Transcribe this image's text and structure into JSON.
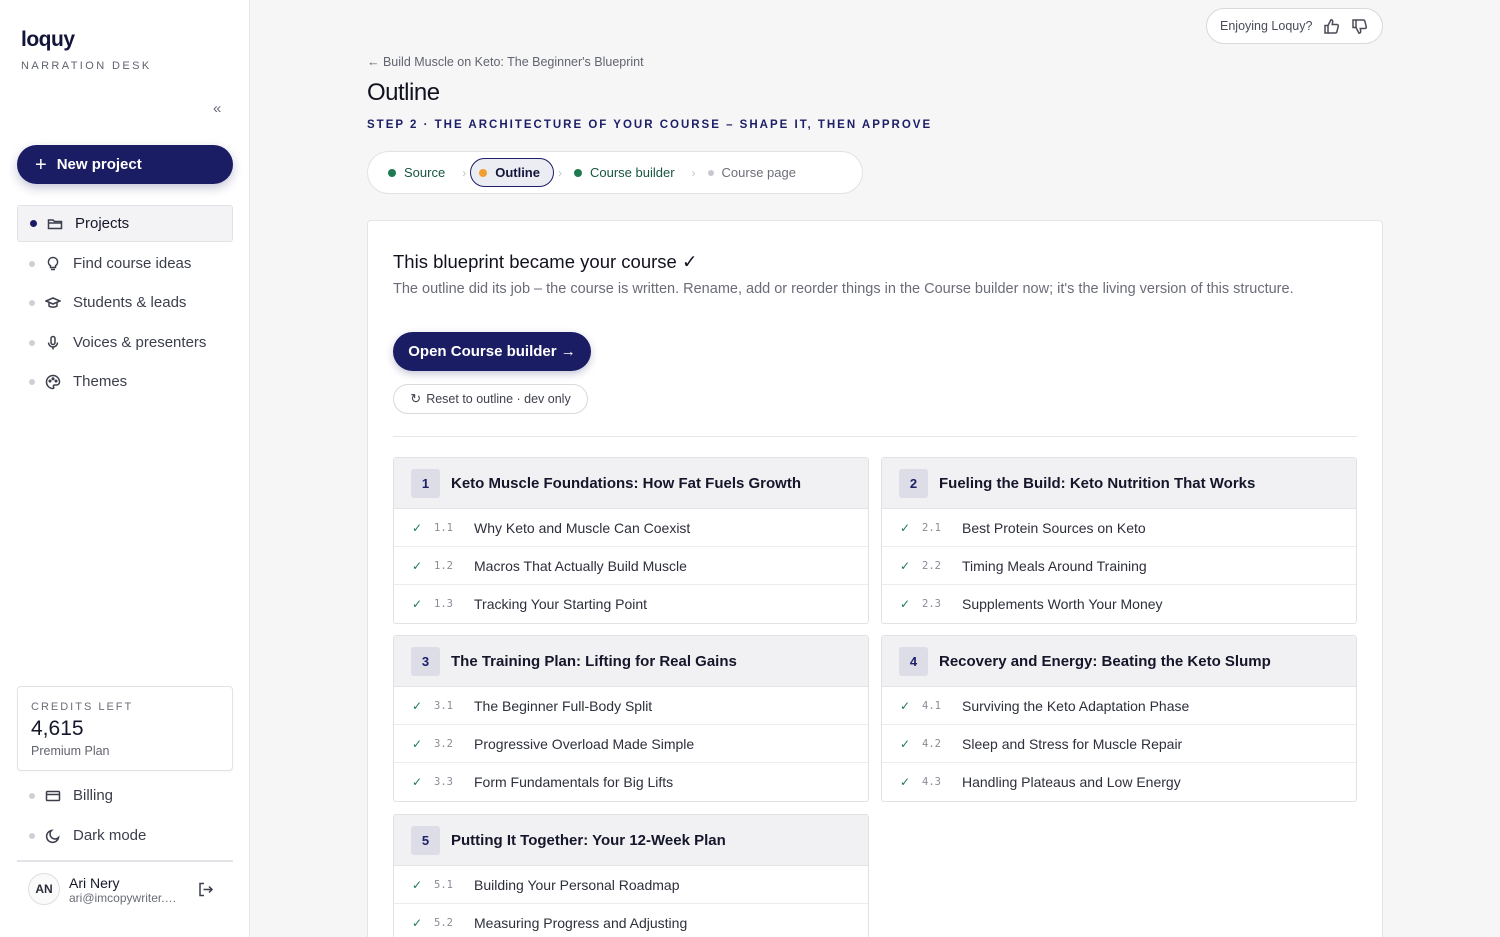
{
  "app": {
    "logo": "loquy",
    "logo_sub": "NARRATION DESK",
    "collapse_glyph": "«"
  },
  "sidebar": {
    "new_project_label": "New project",
    "items": [
      {
        "label": "Projects",
        "icon": "folder-icon",
        "active": true
      },
      {
        "label": "Find course ideas",
        "icon": "lightbulb-icon"
      },
      {
        "label": "Students & leads",
        "icon": "graduation-cap-icon"
      },
      {
        "label": "Voices & presenters",
        "icon": "microphone-icon"
      },
      {
        "label": "Themes",
        "icon": "palette-icon"
      }
    ],
    "credits": {
      "label": "CREDITS LEFT",
      "value": "4,615",
      "plan": "Premium Plan"
    },
    "bottom_items": [
      {
        "label": "Billing",
        "icon": "credit-card-icon"
      },
      {
        "label": "Dark mode",
        "icon": "moon-icon"
      }
    ],
    "user": {
      "initials": "AN",
      "name": "Ari Nery",
      "email": "ari@imcopywriter.com"
    }
  },
  "feedback": {
    "label": "Enjoying Loquy?"
  },
  "header": {
    "breadcrumb": "← Build Muscle on Keto: The Beginner's Blueprint",
    "title": "Outline",
    "step_label": "STEP 2 · THE ARCHITECTURE OF YOUR COURSE – SHAPE IT, THEN APPROVE"
  },
  "stepper": [
    {
      "label": "Source",
      "state": "done"
    },
    {
      "label": "Outline",
      "state": "current"
    },
    {
      "label": "Course builder",
      "state": "done"
    },
    {
      "label": "Course page",
      "state": "pending"
    }
  ],
  "card": {
    "title": "This blueprint became your course ✓",
    "description": "The outline did its job – the course is written. Rename, add or reorder things in the Course builder now; it's the living version of this structure.",
    "open_button": "Open Course builder →",
    "reset_button": "Reset to outline · dev only"
  },
  "modules": [
    {
      "num": "1",
      "title": "Keto Muscle Foundations: How Fat Fuels Growth",
      "lessons": [
        {
          "num": "1.1",
          "title": "Why Keto and Muscle Can Coexist"
        },
        {
          "num": "1.2",
          "title": "Macros That Actually Build Muscle"
        },
        {
          "num": "1.3",
          "title": "Tracking Your Starting Point"
        }
      ]
    },
    {
      "num": "2",
      "title": "Fueling the Build: Keto Nutrition That Works",
      "lessons": [
        {
          "num": "2.1",
          "title": "Best Protein Sources on Keto"
        },
        {
          "num": "2.2",
          "title": "Timing Meals Around Training"
        },
        {
          "num": "2.3",
          "title": "Supplements Worth Your Money"
        }
      ]
    },
    {
      "num": "3",
      "title": "The Training Plan: Lifting for Real Gains",
      "lessons": [
        {
          "num": "3.1",
          "title": "The Beginner Full-Body Split"
        },
        {
          "num": "3.2",
          "title": "Progressive Overload Made Simple"
        },
        {
          "num": "3.3",
          "title": "Form Fundamentals for Big Lifts"
        }
      ]
    },
    {
      "num": "4",
      "title": "Recovery and Energy: Beating the Keto Slump",
      "lessons": [
        {
          "num": "4.1",
          "title": "Surviving the Keto Adaptation Phase"
        },
        {
          "num": "4.2",
          "title": "Sleep and Stress for Muscle Repair"
        },
        {
          "num": "4.3",
          "title": "Handling Plateaus and Low Energy"
        }
      ]
    },
    {
      "num": "5",
      "title": "Putting It Together: Your 12-Week Plan",
      "lessons": [
        {
          "num": "5.1",
          "title": "Building Your Personal Roadmap"
        },
        {
          "num": "5.2",
          "title": "Measuring Progress and Adjusting"
        }
      ]
    }
  ],
  "colors": {
    "brand": "#1a1d63",
    "done": "#1f7a52",
    "current": "#f0a030"
  }
}
